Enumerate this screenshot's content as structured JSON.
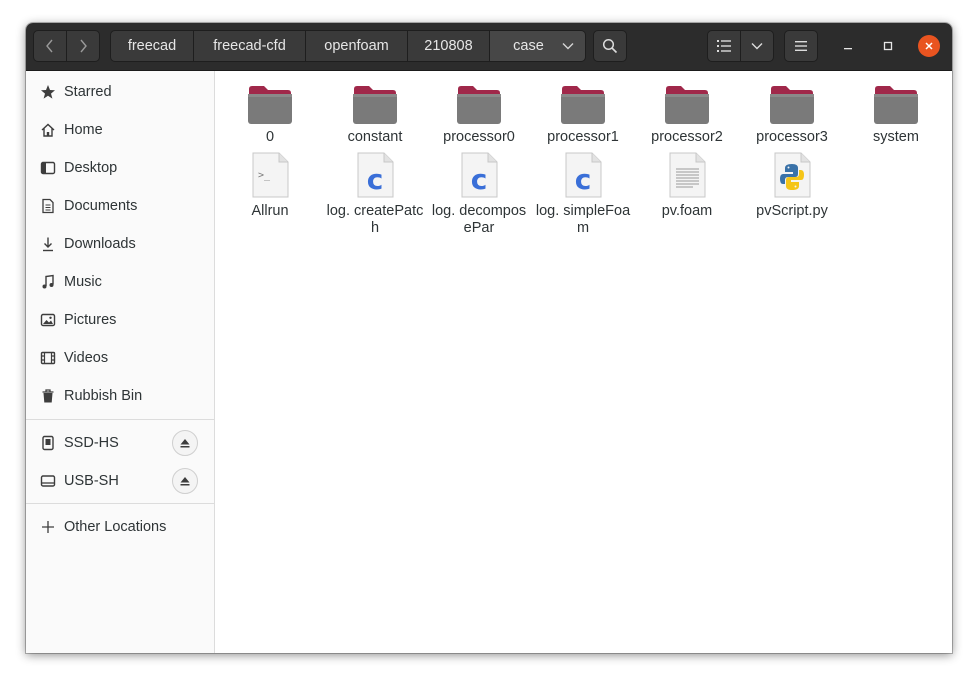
{
  "path": {
    "crumbs": [
      "freecad",
      "freecad-cfd",
      "openfoam",
      "210808",
      "case"
    ]
  },
  "sidebar": {
    "places": [
      {
        "label": "Starred",
        "icon": "star-icon"
      },
      {
        "label": "Home",
        "icon": "home-icon"
      },
      {
        "label": "Desktop",
        "icon": "desktop-icon"
      },
      {
        "label": "Documents",
        "icon": "documents-icon"
      },
      {
        "label": "Downloads",
        "icon": "downloads-icon"
      },
      {
        "label": "Music",
        "icon": "music-icon"
      },
      {
        "label": "Pictures",
        "icon": "pictures-icon"
      },
      {
        "label": "Videos",
        "icon": "videos-icon"
      },
      {
        "label": "Rubbish Bin",
        "icon": "trash-icon"
      }
    ],
    "devices": [
      {
        "label": "SSD-HS",
        "icon": "drive-icon"
      },
      {
        "label": "USB-SH",
        "icon": "usb-drive-icon"
      }
    ],
    "other": {
      "label": "Other Locations",
      "icon": "plus-icon"
    }
  },
  "files": {
    "row1": [
      {
        "name": "0",
        "type": "folder"
      },
      {
        "name": "constant",
        "type": "folder"
      },
      {
        "name": "processor0",
        "type": "folder"
      },
      {
        "name": "processor1",
        "type": "folder"
      },
      {
        "name": "processor2",
        "type": "folder"
      },
      {
        "name": "processor3",
        "type": "folder"
      },
      {
        "name": "system",
        "type": "folder"
      }
    ],
    "row2": [
      {
        "name": "Allrun",
        "type": "script"
      },
      {
        "name": "log. createPatch",
        "type": "c-source"
      },
      {
        "name": "log. decomposePar",
        "type": "c-source"
      },
      {
        "name": "log. simpleFoam",
        "type": "c-source"
      },
      {
        "name": "pv.foam",
        "type": "text"
      },
      {
        "name": "pvScript.py",
        "type": "python"
      }
    ]
  },
  "colors": {
    "folder_tab": "#a0284a",
    "folder_body": "#7a7a7a",
    "accent_close": "#e95420",
    "c_letter": "#3a6fd8"
  }
}
